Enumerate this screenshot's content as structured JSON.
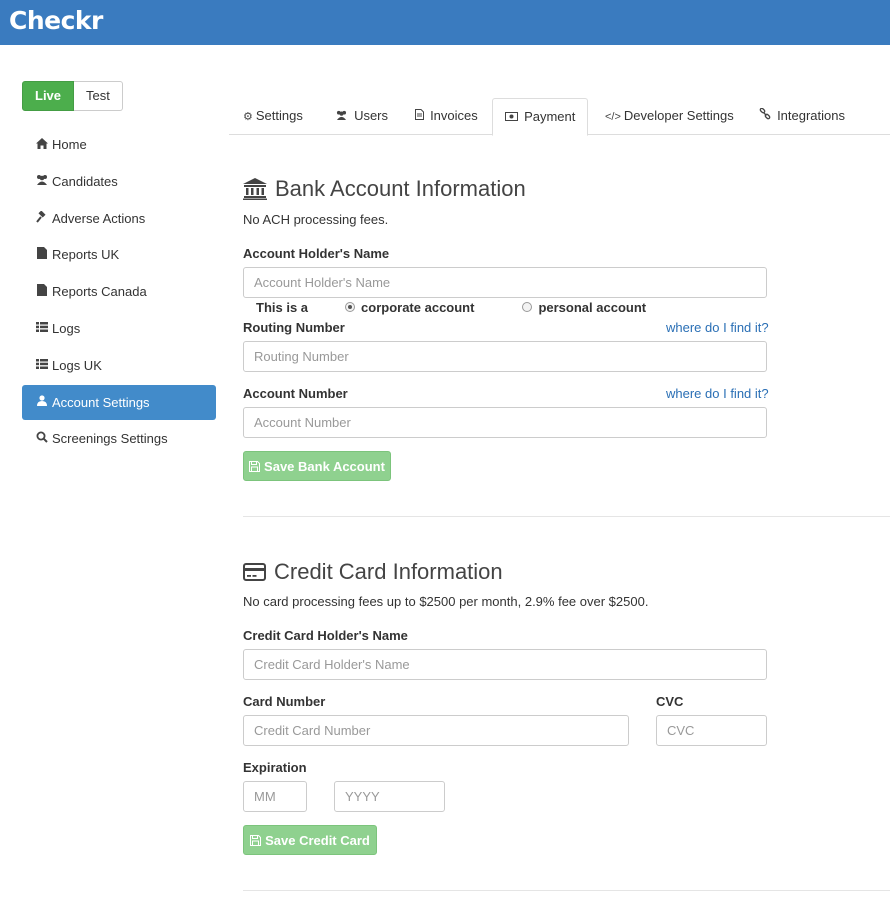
{
  "app": {
    "logo": "Checkr"
  },
  "environment": {
    "live_label": "Live",
    "test_label": "Test",
    "selected": "Live"
  },
  "sidebar": {
    "items": [
      {
        "label": "Home",
        "icon": "home-icon",
        "glyph": "⌂"
      },
      {
        "label": "Candidates",
        "icon": "users-icon",
        "glyph": "👥"
      },
      {
        "label": "Adverse Actions",
        "icon": "gavel-icon",
        "glyph": "⚒"
      },
      {
        "label": "Reports UK",
        "icon": "file-icon",
        "glyph": "▮"
      },
      {
        "label": "Reports Canada",
        "icon": "file-icon",
        "glyph": "▮"
      },
      {
        "label": "Logs",
        "icon": "list-icon",
        "glyph": "☰"
      },
      {
        "label": "Logs UK",
        "icon": "list-icon",
        "glyph": "☰"
      },
      {
        "label": "Account Settings",
        "icon": "user-icon",
        "glyph": "👤",
        "active": true
      },
      {
        "label": "Screenings Settings",
        "icon": "search-icon",
        "glyph": "🔍"
      }
    ]
  },
  "tabs": [
    {
      "label": "Settings",
      "icon": "cog-icon",
      "glyph": "⚙"
    },
    {
      "label": "Users",
      "icon": "users-icon",
      "glyph": "👥"
    },
    {
      "label": "Invoices",
      "icon": "file-text-icon",
      "glyph": "🗎"
    },
    {
      "label": "Payment",
      "icon": "money-icon",
      "glyph": "▭",
      "active": true
    },
    {
      "label": "Developer Settings",
      "icon": "code-icon",
      "glyph": "</>"
    },
    {
      "label": "Integrations",
      "icon": "link-icon",
      "glyph": "⚭"
    }
  ],
  "bank": {
    "title": "Bank Account Information",
    "note": "No ACH processing fees.",
    "holder_label": "Account Holder's Name",
    "holder_placeholder": "Account Holder's Name",
    "account_type_prefix": "This is a",
    "corporate_label": "corporate account",
    "personal_label": "personal account",
    "selected_type": "corporate account",
    "routing_label": "Routing Number",
    "routing_help": "where do I find it?",
    "routing_placeholder": "Routing Number",
    "account_label": "Account Number",
    "account_help": "where do I find it?",
    "account_placeholder": "Account Number",
    "save_label": "Save Bank Account"
  },
  "card": {
    "title": "Credit Card Information",
    "note": "No card processing fees up to $2500 per month, 2.9% fee over $2500.",
    "holder_label": "Credit Card Holder's Name",
    "holder_placeholder": "Credit Card Holder's Name",
    "number_label": "Card Number",
    "number_placeholder": "Credit Card Number",
    "cvc_label": "CVC",
    "cvc_placeholder": "CVC",
    "expiration_label": "Expiration",
    "month_placeholder": "MM",
    "year_placeholder": "YYYY",
    "save_label": "Save Credit Card"
  },
  "colors": {
    "brand": "#3a7bbf",
    "live_green": "#4cae4c",
    "active_blue": "#428bca",
    "save_green": "#8fd18f",
    "link": "#2a6fb5"
  }
}
